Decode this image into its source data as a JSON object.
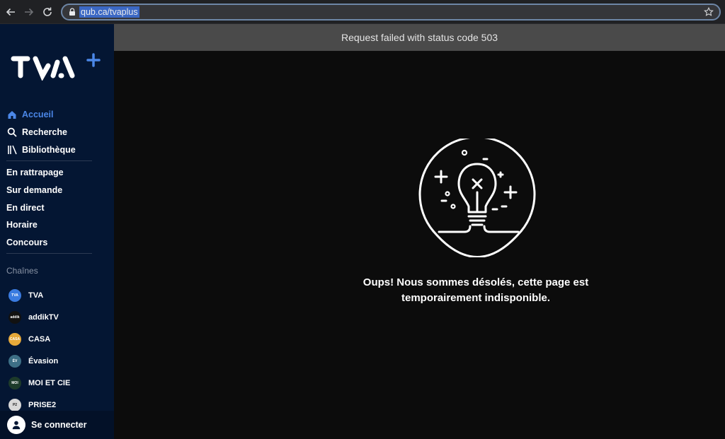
{
  "browser": {
    "url": "qub.ca/tvaplus"
  },
  "sidebar": {
    "logo_alt": "TVA+",
    "primary": [
      {
        "label": "Accueil",
        "icon": "home-icon"
      },
      {
        "label": "Recherche",
        "icon": "search-icon"
      },
      {
        "label": "Bibliothèque",
        "icon": "library-icon"
      }
    ],
    "secondary": [
      {
        "label": "En rattrapage"
      },
      {
        "label": "Sur demande"
      },
      {
        "label": "En direct"
      },
      {
        "label": "Horaire"
      },
      {
        "label": "Concours"
      }
    ],
    "channels_title": "Chaînes",
    "channels": [
      {
        "label": "TVA",
        "color": "#3a7be0"
      },
      {
        "label": "addikTV",
        "color": "#111111"
      },
      {
        "label": "CASA",
        "color": "#e6a93a"
      },
      {
        "label": "Évasion",
        "color": "#3d6f86"
      },
      {
        "label": "MOI ET CIE",
        "color": "#1d3b2a"
      },
      {
        "label": "PRISE2",
        "color": "#d9d9d9"
      }
    ],
    "login_label": "Se connecter",
    "accent_color": "#4b87e8"
  },
  "main": {
    "error_banner": "Request failed with status code 503",
    "message_line1": "Oups! Nous sommes désolés, cette page est",
    "message_line2": "temporairement indisponible.",
    "illustration": "lightbulb-icon"
  }
}
